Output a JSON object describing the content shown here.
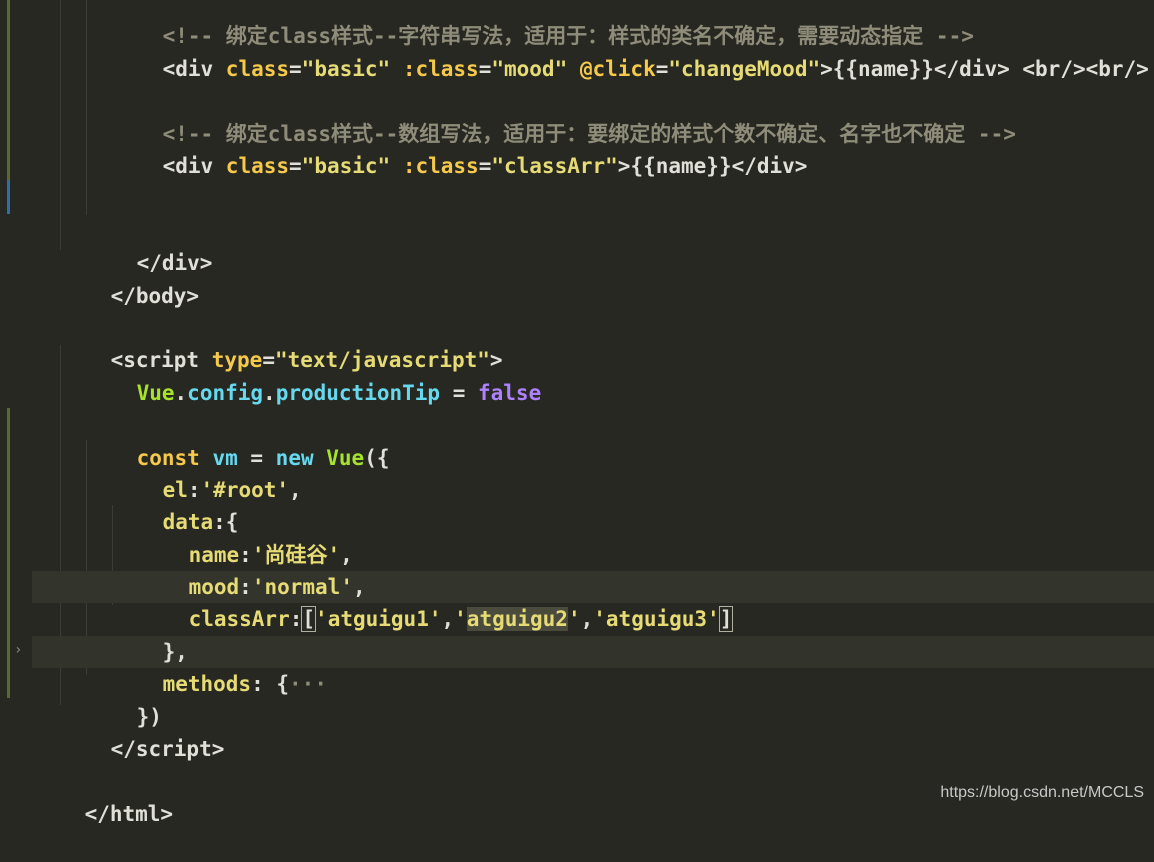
{
  "editor": {
    "lines": {
      "comment1": "<!-- 绑定class样式--字符串写法，适用于：样式的类名不确定，需要动态指定 -->",
      "div1_open": "<div ",
      "div1_class": "class",
      "div1_eq": "=",
      "div1_classval": "\"basic\"",
      "div1_bind": " :class",
      "div1_eq2": "=",
      "div1_bindval": "\"mood\"",
      "div1_click": " @click",
      "div1_eq3": "=",
      "div1_clickval": "\"changeMood\"",
      "div1_rest": ">{{name}}</div> <br/><br/>",
      "comment2": "<!-- 绑定class样式--数组写法，适用于：要绑定的样式个数不确定、名字也不确定 -->",
      "div2_open": "<div ",
      "div2_class": "class",
      "div2_eq": "=",
      "div2_classval": "\"basic\"",
      "div2_bind": " :class",
      "div2_eq2": "=",
      "div2_bindval": "\"classArr\"",
      "div2_rest": ">{{name}}</div>",
      "div_close": "</div>",
      "body_close": "</body>",
      "script_open": "<script ",
      "script_type": "type",
      "script_eq": "=",
      "script_typeval": "\"text/javascript\"",
      "script_gt": ">",
      "vue_obj": "Vue",
      "vue_dot1": ".",
      "vue_config": "config",
      "vue_dot2": ".",
      "vue_tip": "productionTip",
      "vue_eq": " = ",
      "vue_false": "false",
      "const_kw": "const ",
      "const_var": "vm",
      "const_eq": " = ",
      "const_new": "new ",
      "const_vue": "Vue",
      "const_paren": "({",
      "el_key": "el",
      "el_colon": ":",
      "el_val": "'#root'",
      "el_comma": ",",
      "data_key": "data",
      "data_rest": ":{",
      "name_key": "name",
      "name_colon": ":",
      "name_val": "'尚硅谷'",
      "name_comma": ",",
      "mood_key": "mood",
      "mood_colon": ":",
      "mood_val": "'normal'",
      "mood_comma": ",",
      "arr_key": "classArr",
      "arr_colon": ":",
      "arr_open": "[",
      "arr_v1": "'atguigu1'",
      "arr_c1": ",",
      "arr_q2": "'",
      "arr_v2": "atguigu2",
      "arr_q2b": "'",
      "arr_c2": ",",
      "arr_v3": "'atguigu3'",
      "arr_close": "]",
      "data_close": "},",
      "methods_key": "methods",
      "methods_rest": ": {",
      "methods_fold": "···",
      "vm_close": "})",
      "script_close": "</script>",
      "html_close": "</html>"
    }
  },
  "watermark": "https://blog.csdn.net/MCCLS"
}
